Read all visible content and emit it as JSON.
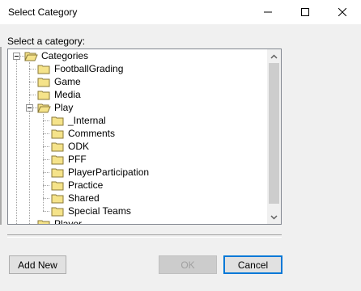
{
  "window": {
    "title": "Select Category",
    "controls": {
      "minimize": "minimize",
      "maximize": "maximize",
      "close": "close"
    }
  },
  "label": "Select a category:",
  "tree": {
    "root": {
      "label": "Categories",
      "expanded": true
    },
    "children": [
      {
        "label": "FootballGrading"
      },
      {
        "label": "Game"
      },
      {
        "label": "Media"
      },
      {
        "label": "Play",
        "expanded": true,
        "children": [
          {
            "label": "_Internal"
          },
          {
            "label": "Comments"
          },
          {
            "label": "ODK"
          },
          {
            "label": "PFF"
          },
          {
            "label": "PlayerParticipation"
          },
          {
            "label": "Practice"
          },
          {
            "label": "Shared"
          },
          {
            "label": "Special Teams"
          }
        ]
      },
      {
        "label": "Player"
      }
    ]
  },
  "buttons": {
    "add_new": "Add New",
    "ok": "OK",
    "cancel": "Cancel"
  },
  "colors": {
    "folder_fill": "#f5e38a",
    "folder_stroke": "#8a7a3a",
    "focus_border": "#0078d7"
  }
}
